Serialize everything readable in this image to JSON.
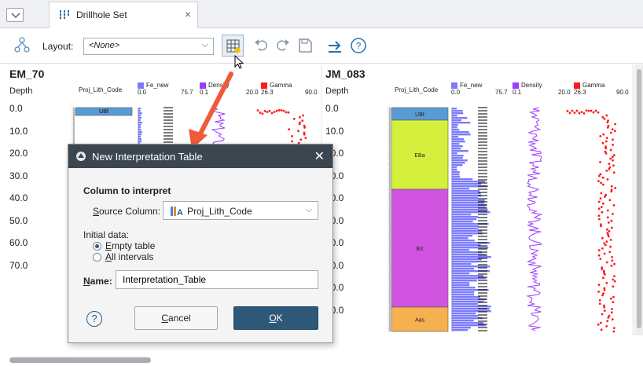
{
  "tabbar": {
    "tab_label": "Drillhole Set",
    "close_symbol": "×"
  },
  "toolbar": {
    "layout_label": "Layout:",
    "layout_value": "<None>"
  },
  "wells": [
    {
      "name": "EM_70",
      "depth_header": "Depth",
      "lith_header": "Proj_Lith_Code",
      "depth_ticks": [
        "0.0",
        "10.0",
        "20.0",
        "30.0",
        "40.0",
        "50.0",
        "60.0",
        "70.0"
      ],
      "logs": [
        {
          "name": "Fe_new",
          "min": "0.0",
          "max": "75.7",
          "color": "#7b7bff"
        },
        {
          "name": "Density",
          "min": "0.1",
          "max": "20.0",
          "color": "#9b3dff"
        },
        {
          "name": "Gamma",
          "min": "26.3",
          "max": "90.0",
          "color": "#ff1a1a"
        }
      ],
      "lith_units": [
        {
          "code": "UBf",
          "color": "#5b9bd5"
        }
      ]
    },
    {
      "name": "JM_083",
      "depth_header": "Depth",
      "lith_header": "Proj_Lith_Code",
      "depth_ticks": [
        "0.0",
        "10.0",
        "20.0",
        "30.0",
        "40.0",
        "50.0",
        "60.0",
        "70.0",
        "80.0",
        "90.0"
      ],
      "logs": [
        {
          "name": "Fe_new",
          "min": "0.0",
          "max": "75.7",
          "color": "#7b7bff"
        },
        {
          "name": "Density",
          "min": "0.1",
          "max": "20.0",
          "color": "#9b3dff"
        },
        {
          "name": "Gamma",
          "min": "26.3",
          "max": "90.0",
          "color": "#ff1a1a"
        }
      ],
      "lith_units": [
        {
          "code": "UBf",
          "color": "#5b9bd5"
        },
        {
          "code": "EBa",
          "color": "#d5f03c"
        },
        {
          "code": "BX",
          "color": "#d154e0"
        },
        {
          "code": "Aas",
          "color": "#f5b04f"
        }
      ]
    }
  ],
  "dialog": {
    "title": "New Interpretation Table",
    "section_label": "Column to interpret",
    "source_column_label_u": "S",
    "source_column_label_rest": "ource Column:",
    "source_column_value": "Proj_Lith_Code",
    "initial_data_label": "Initial data:",
    "radio_empty_u": "E",
    "radio_empty_rest": "mpty table",
    "radio_all_u": "A",
    "radio_all_rest": "ll intervals",
    "name_label_u": "N",
    "name_label_rest": "ame:",
    "name_value": "Interpretation_Table",
    "help_symbol": "?",
    "cancel_u": "C",
    "cancel_rest": "ancel",
    "ok_u": "O",
    "ok_rest": "K",
    "close_symbol": "✕"
  }
}
